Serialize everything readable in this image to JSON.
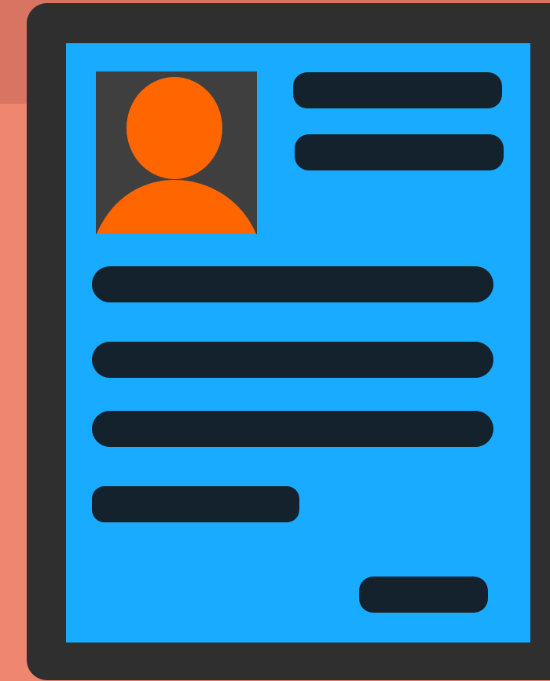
{
  "icon": "id-card-profile-icon",
  "colors": {
    "background": "#ef8670",
    "background_top": "#d97462",
    "frame": "#2f2f2f",
    "screen": "#19abff",
    "photo_bg": "#3f3f3f",
    "avatar": "#ff6600",
    "text_bar": "#13222d"
  }
}
